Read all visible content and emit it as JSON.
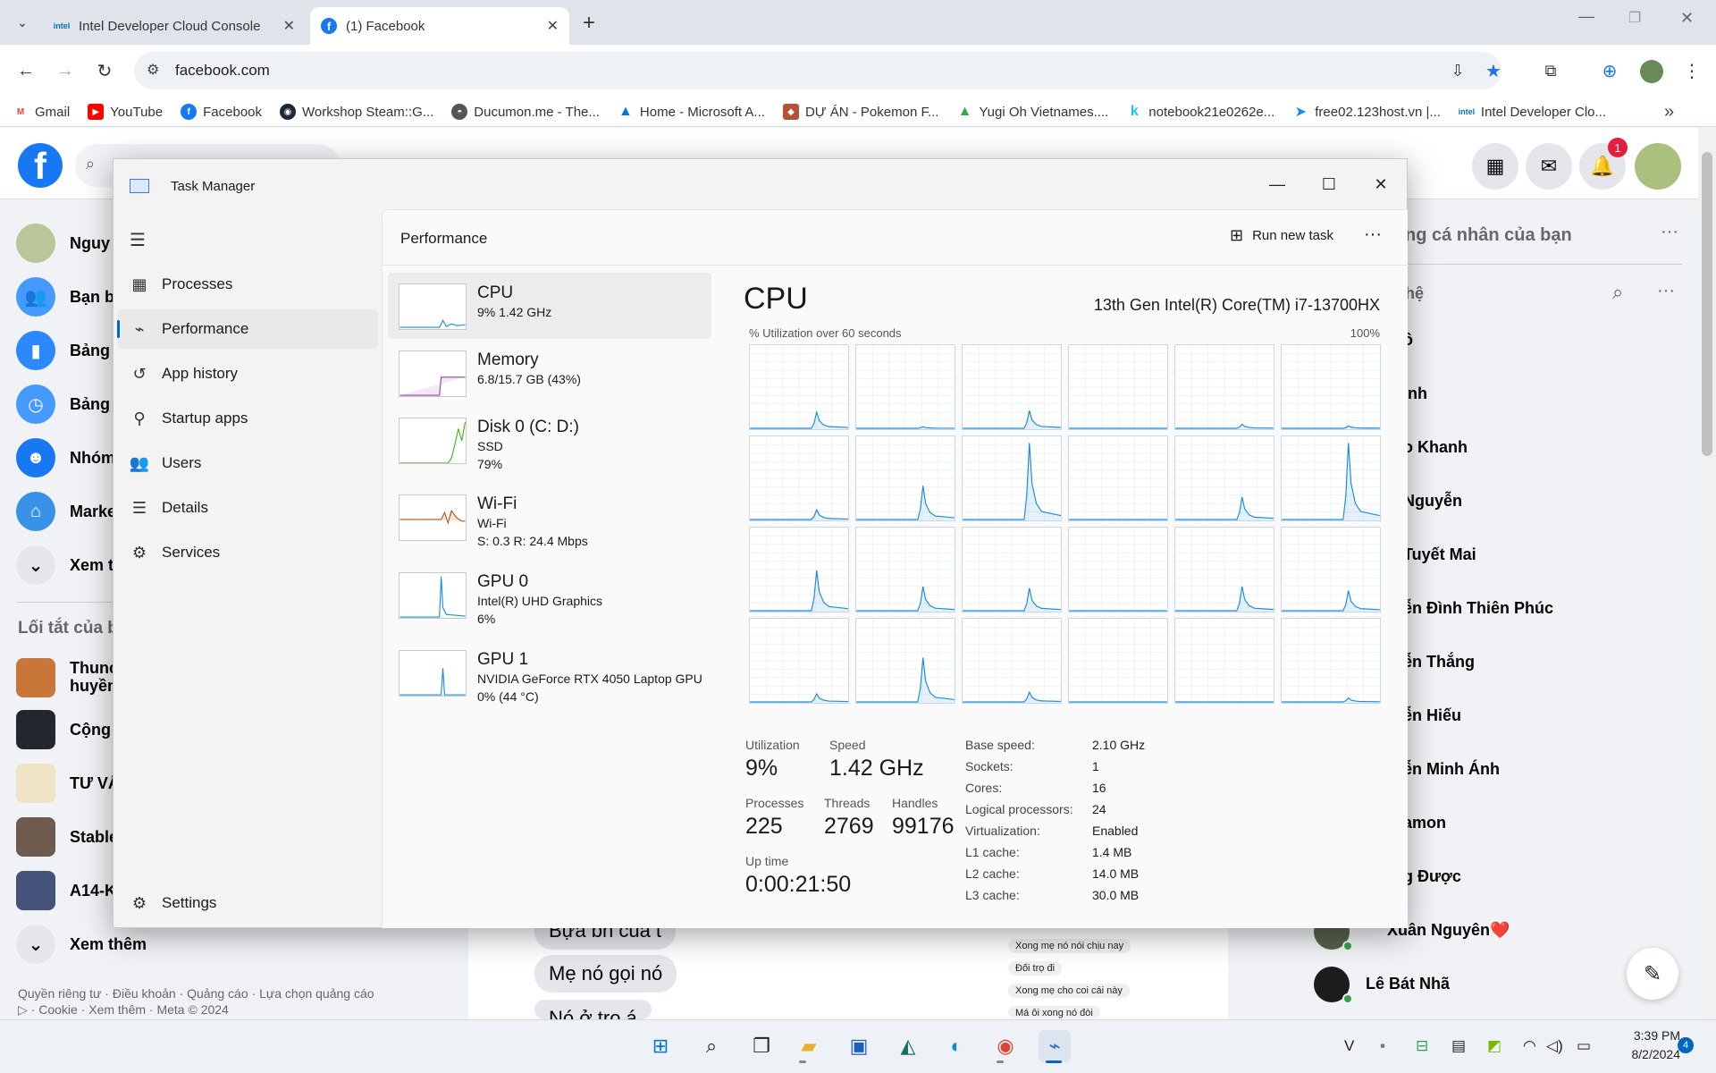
{
  "browser": {
    "tabs": [
      {
        "title": "Intel Developer Cloud Console",
        "favicon": "intel-icon",
        "active": false
      },
      {
        "title": "(1) Facebook",
        "favicon": "facebook-icon",
        "active": true
      }
    ],
    "url": "facebook.com",
    "bookmarks": [
      {
        "label": "Gmail",
        "icon": "gmail-icon"
      },
      {
        "label": "YouTube",
        "icon": "youtube-icon"
      },
      {
        "label": "Facebook",
        "icon": "facebook-icon"
      },
      {
        "label": "Workshop Steam::G...",
        "icon": "steam-icon"
      },
      {
        "label": "Ducumon.me - The...",
        "icon": "ducumon-icon"
      },
      {
        "label": "Home - Microsoft A...",
        "icon": "azure-icon"
      },
      {
        "label": "DỰ ÁN - Pokemon F...",
        "icon": "pokemon-icon"
      },
      {
        "label": "Yugi Oh Vietnames....",
        "icon": "drive-icon"
      },
      {
        "label": "notebook21e0262e...",
        "icon": "kaggle-icon"
      },
      {
        "label": "free02.123host.vn |...",
        "icon": "host-icon"
      },
      {
        "label": "Intel Developer Clo...",
        "icon": "intel-icon"
      }
    ],
    "overflow": "»"
  },
  "facebook": {
    "notification_count": "1",
    "left_nav": [
      {
        "label": "Nguy",
        "icon": "avatar"
      },
      {
        "label": "Bạn b",
        "icon": "friends-icon"
      },
      {
        "label": "Bảng",
        "icon": "dashboard-icon"
      },
      {
        "label": "Bảng",
        "icon": "memories-icon"
      },
      {
        "label": "Nhóm",
        "icon": "groups-icon"
      },
      {
        "label": "Marke",
        "icon": "marketplace-icon"
      },
      {
        "label": "Xem t",
        "icon": "chevron-down-icon"
      }
    ],
    "shortcuts_heading": "Lối tắt của b",
    "shortcuts": [
      {
        "label": "Thunc\nhuyền"
      },
      {
        "label": "Cộng"
      },
      {
        "label": "TƯ VẤ"
      },
      {
        "label": "Stable"
      },
      {
        "label": "A14-K"
      }
    ],
    "see_more": "Xem thêm",
    "footer": "Quyền riêng tư · Điều khoản · Quảng cáo · Lựa chọn quảng cáo ▷ · Cookie · Xem thêm · Meta © 2024",
    "right_heading": "ng cá nhân của bạn",
    "contacts_heading": "hệ",
    "contacts": [
      "ô",
      "inh",
      "o Khanh",
      "Nguyễn",
      "Tuyết Mai",
      "ễn Đình Thiên Phúc",
      "ễn Thắng",
      "ễn Hiếu",
      "ễn Minh Ánh",
      "amon",
      "g Được",
      "Xuân Nguyên❤️",
      "Lê Bát Nhã"
    ],
    "chat_bubbles": [
      "Bựa bh của t",
      "Mẹ nó gọi nó",
      "Nó ở trọ á"
    ],
    "small_bubbles": [
      "Xong mẹ nó nói chịu nay",
      "Đối trọ đi",
      "Xong mẹ cho coi cái này",
      "Má ôi xong nó đòi"
    ]
  },
  "task_manager": {
    "title": "Task Manager",
    "nav": [
      {
        "label": "Processes",
        "icon": "processes-icon"
      },
      {
        "label": "Performance",
        "icon": "performance-icon",
        "active": true
      },
      {
        "label": "App history",
        "icon": "app-history-icon"
      },
      {
        "label": "Startup apps",
        "icon": "startup-icon"
      },
      {
        "label": "Users",
        "icon": "users-icon"
      },
      {
        "label": "Details",
        "icon": "details-icon"
      },
      {
        "label": "Services",
        "icon": "services-icon"
      }
    ],
    "settings_label": "Settings",
    "page_title": "Performance",
    "run_new_task": "Run new task",
    "resources": [
      {
        "name": "CPU",
        "sub1": "9%  1.42 GHz",
        "sub2": "",
        "color": "#1f8dd6"
      },
      {
        "name": "Memory",
        "sub1": "6.8/15.7 GB (43%)",
        "sub2": "",
        "color": "#9a3fb5"
      },
      {
        "name": "Disk 0 (C: D:)",
        "sub1": "SSD",
        "sub2": "79%",
        "color": "#4caf28"
      },
      {
        "name": "Wi-Fi",
        "sub1": "Wi-Fi",
        "sub2": "S: 0.3  R: 24.4 Mbps",
        "color": "#b6561b"
      },
      {
        "name": "GPU 0",
        "sub1": "Intel(R) UHD Graphics",
        "sub2": "6%",
        "color": "#1f8dd6"
      },
      {
        "name": "GPU 1",
        "sub1": "NVIDIA GeForce RTX 4050 Laptop GPU",
        "sub2": "0%  (44 °C)",
        "color": "#1f8dd6"
      }
    ],
    "cpu": {
      "heading": "CPU",
      "model": "13th Gen Intel(R) Core(TM) i7-13700HX",
      "graph_caption": "% Utilization over 60 seconds",
      "graph_max": "100%",
      "core_peaks": [
        20,
        2,
        22,
        0,
        5,
        3,
        12,
        42,
        95,
        0,
        28,
        95,
        50,
        30,
        28,
        0,
        30,
        25,
        10,
        55,
        12,
        0,
        0,
        5
      ],
      "stats": {
        "utilization_label": "Utilization",
        "utilization": "9%",
        "speed_label": "Speed",
        "speed": "1.42 GHz",
        "processes_label": "Processes",
        "processes": "225",
        "threads_label": "Threads",
        "threads": "2769",
        "handles_label": "Handles",
        "handles": "99176",
        "uptime_label": "Up time",
        "uptime": "0:00:21:50"
      },
      "specs": [
        {
          "k": "Base speed:",
          "v": "2.10 GHz"
        },
        {
          "k": "Sockets:",
          "v": "1"
        },
        {
          "k": "Cores:",
          "v": "16"
        },
        {
          "k": "Logical processors:",
          "v": "24"
        },
        {
          "k": "Virtualization:",
          "v": "Enabled"
        },
        {
          "k": "L1 cache:",
          "v": "1.4 MB"
        },
        {
          "k": "L2 cache:",
          "v": "14.0 MB"
        },
        {
          "k": "L3 cache:",
          "v": "30.0 MB"
        }
      ]
    }
  },
  "taskbar": {
    "clock_time": "3:39 PM",
    "clock_date": "8/2/2024",
    "notification_badge": "4"
  }
}
